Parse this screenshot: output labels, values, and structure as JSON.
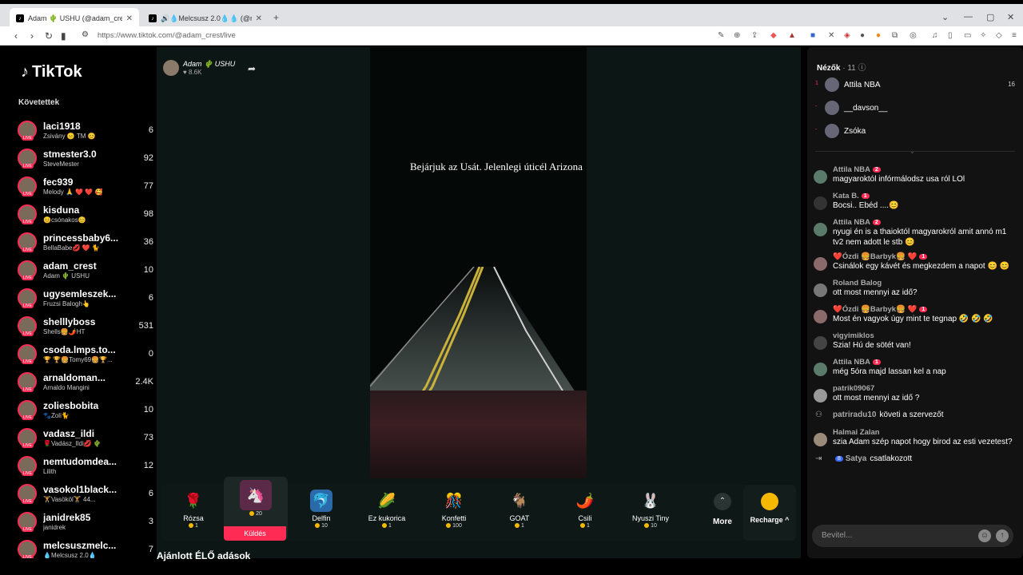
{
  "browser": {
    "tabs": [
      {
        "title": "Adam 🌵 USHU (@adam_crest"
      },
      {
        "title": "🔊💧Melcsusz 2.0💧💧 (@melcsu"
      }
    ],
    "url": "https://www.tiktok.com/@adam_crest/live"
  },
  "sidebar": {
    "logo": "TikTok",
    "following_title": "Követettek",
    "items": [
      {
        "name": "laci1918",
        "sub": "Zsivány 😐 TM 😊",
        "count": "6"
      },
      {
        "name": "stmester3.0",
        "sub": "SteveMester",
        "count": "92"
      },
      {
        "name": "fec939",
        "sub": "Melody 🙏 ❤️ ❤️ 🥰",
        "count": "77"
      },
      {
        "name": "kisduna",
        "sub": "😊csónakos😊",
        "count": "98"
      },
      {
        "name": "princessbaby6...",
        "sub": "BellaBabe💋 ❤️ 🐈",
        "count": "36"
      },
      {
        "name": "adam_crest",
        "sub": "Adam 🌵 USHU",
        "count": "10"
      },
      {
        "name": "ugysemleszek...",
        "sub": "Fruzsi Balogh👆",
        "count": "6"
      },
      {
        "name": "shelllyboss",
        "sub": "Shells🍔🌶️HT",
        "count": "531"
      },
      {
        "name": "csoda.lmps.to...",
        "sub": "🏆 🏆🍔Tomy69🍔🏆...",
        "count": "0"
      },
      {
        "name": "arnaldoman...",
        "sub": "Arnaldo Mangini",
        "count": "2.4K"
      },
      {
        "name": "zoliesbobita",
        "sub": "🐾Zoli🐈",
        "count": "10"
      },
      {
        "name": "vadasz_ildi",
        "sub": "🌹Vadász_Ildi💋 🌵",
        "count": "73"
      },
      {
        "name": "nemtudomdea...",
        "sub": "Lilith",
        "count": "12"
      },
      {
        "name": "vasokol1black...",
        "sub": "🏋️Vasököl🏋️ 44...",
        "count": "6"
      },
      {
        "name": "janidrek85",
        "sub": "janidrek",
        "count": "3"
      },
      {
        "name": "melcsuszmelc...",
        "sub": "💧Melcsusz 2.0💧",
        "count": "7"
      }
    ]
  },
  "stream": {
    "streamer_name": "Adam 🌵 USHU",
    "likes": "♥ 8.6K",
    "overlay_text": "Bejárjuk az Usát. Jelenlegi úticél Arizona",
    "gifts": [
      {
        "name": "Rózsa",
        "price": "1",
        "icon": "🌹"
      },
      {
        "name": "",
        "price": "20",
        "icon": "🦄"
      },
      {
        "name": "Delfin",
        "price": "10",
        "icon": "🐬"
      },
      {
        "name": "Ez kukorica",
        "price": "1",
        "icon": "🌽"
      },
      {
        "name": "Konfetti",
        "price": "100",
        "icon": "🎊"
      },
      {
        "name": "GOAT",
        "price": "1",
        "icon": "🐐"
      },
      {
        "name": "Csili",
        "price": "1",
        "icon": "🌶️"
      },
      {
        "name": "Nyuszi Tiny",
        "price": "10",
        "icon": "🐰"
      }
    ],
    "send_label": "Küldés",
    "more_label": "More",
    "recharge_label": "Recharge ^",
    "recommended_label": "Ajánlott ÉLŐ adások"
  },
  "panel": {
    "viewers_title": "Nézők",
    "viewers_count": "· 11",
    "viewers": [
      {
        "rank": "1",
        "name": "Attila NBA",
        "score": "16"
      },
      {
        "rank": "-",
        "name": "__davson__",
        "score": ""
      },
      {
        "rank": "-",
        "name": "Zsóka",
        "score": ""
      }
    ],
    "chat": [
      {
        "user": "Attila NBA",
        "badge": "2",
        "text": "magyaroktól infórmálodsz usa ról LOl"
      },
      {
        "user": "Kata B.",
        "badge": "1",
        "text": "Bocsi.. Ebéd ....😊"
      },
      {
        "user": "Attila NBA",
        "badge": "2",
        "text": "nyugi én is a thaioktól magyarokról amit annó m1 tv2 nem adott le stb 😊"
      },
      {
        "user": "❤️Ózdi 🍔Barbyk🍔 ❤️",
        "badge": "1",
        "text": "Csinálok egy kávét és megkezdem a napot 😊 😊"
      },
      {
        "user": "Roland Balog",
        "badge": "",
        "text": "ott most mennyi az idő?"
      },
      {
        "user": "❤️Ózdi 🍔Barbyk🍔 ❤️",
        "badge": "1",
        "text": "Most én vagyok úgy mint te tegnap 🤣 🤣 🤣"
      },
      {
        "user": "vigyimiklos",
        "badge": "",
        "text": "Szia! Hú de sötét van!"
      },
      {
        "user": "Attila NBA",
        "badge": "1",
        "text": "még 5óra majd lassan kel a nap"
      },
      {
        "user": "patrik09067",
        "badge": "",
        "text": "ott most mennyi az idő ?"
      }
    ],
    "follow_msg": {
      "user": "patriradu10",
      "text": "követi a szervezőt"
    },
    "chat2": {
      "user": "Halmai Zalan",
      "text": "szia Adam szép napot hogy birod az esti vezetest?"
    },
    "join_msg": {
      "user": "Satya",
      "text": "csatlakozott"
    },
    "input_placeholder": "Bevitel..."
  }
}
